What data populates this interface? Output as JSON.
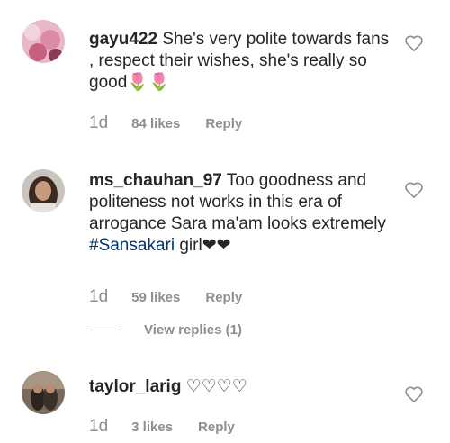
{
  "comments": [
    {
      "username": "gayu422",
      "text": " She's very polite towards fans , respect their wishes, she's really so good",
      "emoji": "🌷🌷",
      "time": "1d",
      "likes": "84 likes",
      "reply": "Reply"
    },
    {
      "username": "ms_chauhan_97",
      "text": " Too goodness and politeness not works in this era of arrogance Sara ma'am looks extremely ",
      "hashtag": "#Sansakari",
      "text_after": " girl",
      "emoji": "❤❤",
      "time": "1d",
      "likes": "59 likes",
      "reply": "Reply",
      "view_replies": "View replies (1)"
    },
    {
      "username": "taylor_larig",
      "emoji": " ♡♡♡♡",
      "time": "1d",
      "likes": "3 likes",
      "reply": "Reply"
    }
  ]
}
